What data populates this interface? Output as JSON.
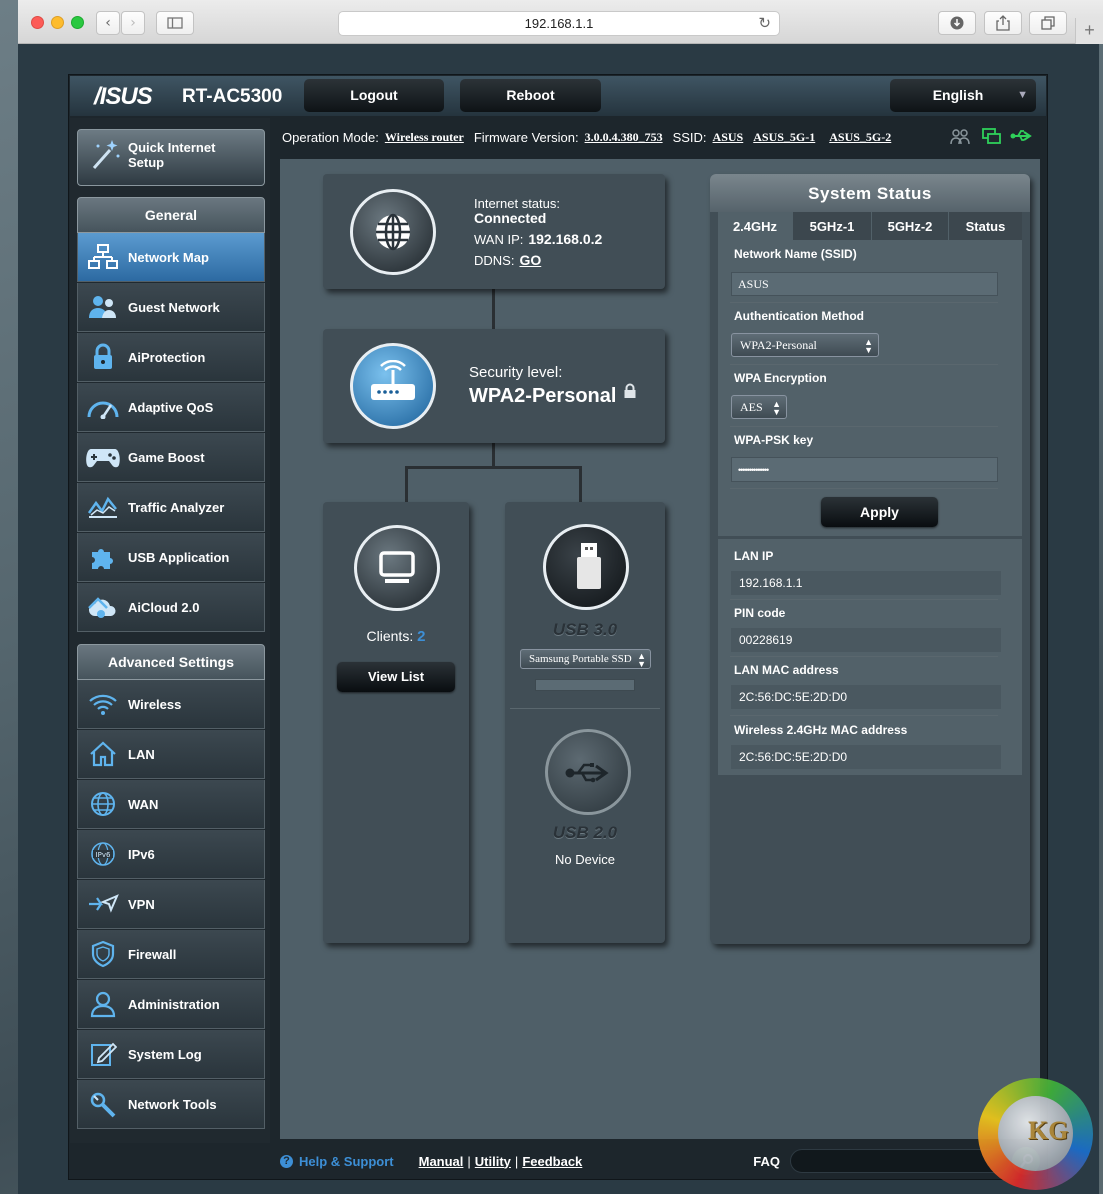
{
  "browser": {
    "url": "192.168.1.1"
  },
  "header": {
    "brand": "/ISUS",
    "model": "RT-AC5300",
    "logout_label": "Logout",
    "reboot_label": "Reboot",
    "language": "English"
  },
  "info": {
    "op_mode_label": "Operation Mode:",
    "op_mode_value": "Wireless router",
    "fw_label": "Firmware Version:",
    "fw_value": "3.0.0.4.380_753",
    "ssid_label": "SSID:",
    "ssids": [
      "ASUS",
      "ASUS_5G-1",
      "ASUS_5G-2"
    ]
  },
  "sidebar": {
    "qis_label_1": "Quick Internet",
    "qis_label_2": "Setup",
    "general_title": "General",
    "general_items": [
      {
        "label": "Network Map",
        "icon": "network-map-icon"
      },
      {
        "label": "Guest Network",
        "icon": "guest-network-icon"
      },
      {
        "label": "AiProtection",
        "icon": "lock-icon"
      },
      {
        "label": "Adaptive QoS",
        "icon": "speedometer-icon"
      },
      {
        "label": "Game Boost",
        "icon": "gamepad-icon"
      },
      {
        "label": "Traffic Analyzer",
        "icon": "chart-icon"
      },
      {
        "label": "USB Application",
        "icon": "puzzle-icon"
      },
      {
        "label": "AiCloud 2.0",
        "icon": "cloud-icon"
      }
    ],
    "advanced_title": "Advanced Settings",
    "advanced_items": [
      {
        "label": "Wireless",
        "icon": "wifi-icon"
      },
      {
        "label": "LAN",
        "icon": "home-icon"
      },
      {
        "label": "WAN",
        "icon": "globe-icon"
      },
      {
        "label": "IPv6",
        "icon": "ipv6-icon"
      },
      {
        "label": "VPN",
        "icon": "vpn-icon"
      },
      {
        "label": "Firewall",
        "icon": "shield-icon"
      },
      {
        "label": "Administration",
        "icon": "user-icon"
      },
      {
        "label": "System Log",
        "icon": "log-icon"
      },
      {
        "label": "Network Tools",
        "icon": "tools-icon"
      }
    ]
  },
  "internet": {
    "status_label": "Internet status:",
    "status_value": "Connected",
    "wan_label": "WAN IP:",
    "wan_value": "192.168.0.2",
    "ddns_label": "DDNS:",
    "ddns_value": "GO"
  },
  "security": {
    "label": "Security level:",
    "value": "WPA2-Personal"
  },
  "clients": {
    "label": "Clients:",
    "count": "2",
    "view_list": "View List"
  },
  "usb": {
    "usb3_label": "USB 3.0",
    "usb3_device": "Samsung Portable SSD",
    "usb2_label": "USB 2.0",
    "usb2_device": "No Device"
  },
  "system_status": {
    "title": "System Status",
    "tabs": [
      "2.4GHz",
      "5GHz-1",
      "5GHz-2",
      "Status"
    ],
    "ssid_label": "Network Name (SSID)",
    "ssid_value": "ASUS",
    "auth_label": "Authentication Method",
    "auth_value": "WPA2-Personal",
    "enc_label": "WPA Encryption",
    "enc_value": "AES",
    "psk_label": "WPA-PSK key",
    "psk_value": "••••••••••••••",
    "apply_label": "Apply",
    "lan_ip_label": "LAN IP",
    "lan_ip_value": "192.168.1.1",
    "pin_label": "PIN code",
    "pin_value": "00228619",
    "lan_mac_label": "LAN MAC address",
    "lan_mac_value": "2C:56:DC:5E:2D:D0",
    "wl_mac_label": "Wireless 2.4GHz MAC address",
    "wl_mac_value": "2C:56:DC:5E:2D:D0"
  },
  "footer": {
    "help": "Help & Support",
    "manual": "Manual",
    "utility": "Utility",
    "feedback": "Feedback",
    "faq": "FAQ",
    "sep": "|"
  },
  "watermark": "KG",
  "colors": {
    "accent": "#3d8fd6",
    "usb_green": "#2fd05a"
  }
}
